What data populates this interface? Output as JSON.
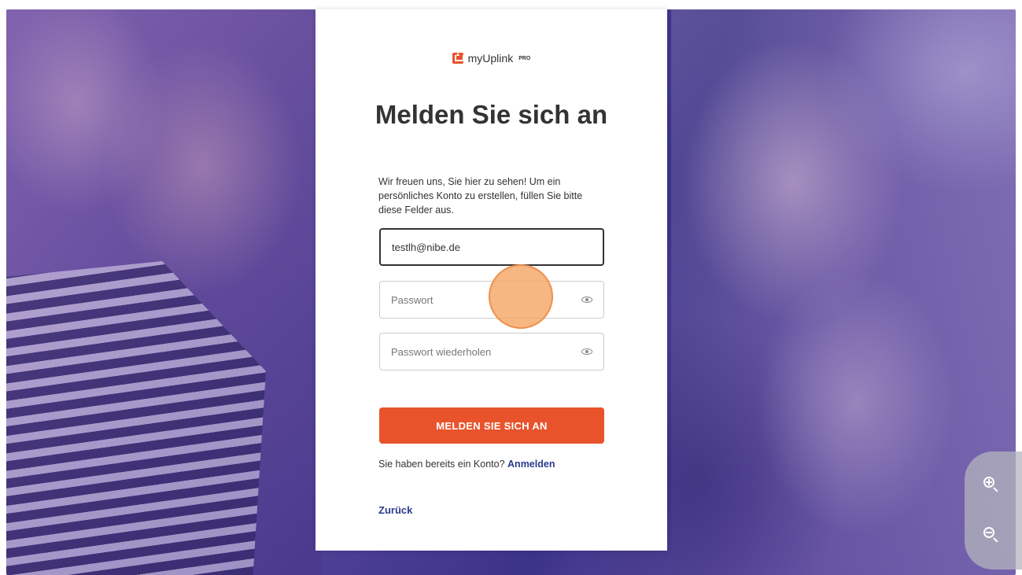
{
  "brand": {
    "name": "myUplink",
    "badge": "PRO"
  },
  "form": {
    "title": "Melden Sie sich an",
    "intro": "Wir freuen uns, Sie hier zu sehen! Um ein persönliches Konto zu erstellen, füllen Sie bitte diese Felder aus.",
    "email_value": "testlh@nibe.de",
    "password_placeholder": "Passwort",
    "password_repeat_placeholder": "Passwort wiederholen",
    "submit_label": "MELDEN SIE SICH AN",
    "has_account_text": "Sie haben bereits ein Konto?",
    "login_link": "Anmelden",
    "back_link": "Zurück"
  },
  "icons": {
    "password_toggle": "eye-icon",
    "password_repeat_toggle": "eye-icon",
    "zoom_in": "zoom-in-icon",
    "zoom_out": "zoom-out-icon"
  },
  "colors": {
    "accent": "#e8532b",
    "link": "#2d3a8c",
    "background_tint": "#4a3d92"
  }
}
